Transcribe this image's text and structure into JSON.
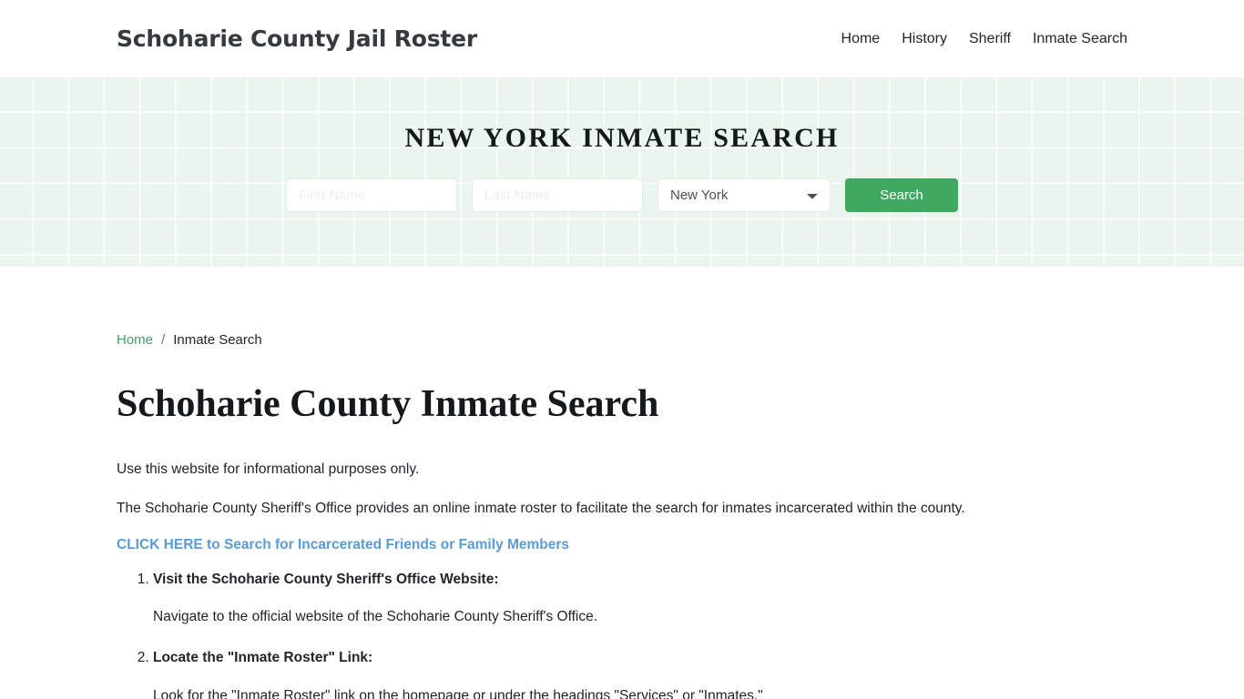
{
  "header": {
    "brand": "Schoharie County Jail Roster",
    "nav": [
      {
        "label": "Home"
      },
      {
        "label": "History"
      },
      {
        "label": "Sheriff"
      },
      {
        "label": "Inmate Search"
      }
    ]
  },
  "hero": {
    "title": "NEW YORK INMATE SEARCH",
    "background_color": "#eaf5ee",
    "form": {
      "first_name_placeholder": "First Name",
      "first_name_value": "",
      "last_name_placeholder": "Last Name",
      "last_name_value": "",
      "state_selected": "New York",
      "state_options": [
        "New York"
      ],
      "search_label": "Search",
      "search_button_color": "#3fa861"
    }
  },
  "breadcrumb": {
    "home_label": "Home",
    "separator": "/",
    "current_label": "Inmate Search",
    "link_color": "#4a9a68"
  },
  "main": {
    "page_title": "Schoharie County Inmate Search",
    "paragraph_1": "Use this website for informational purposes only.",
    "paragraph_2": "The Schoharie County Sheriff's Office provides an online inmate roster to facilitate the search for inmates incarcerated within the county.",
    "cta_link": "CLICK HERE to Search for Incarcerated Friends or Family Members",
    "cta_link_color": "#5b9bd5",
    "steps": [
      {
        "heading": "Visit the Schoharie County Sheriff's Office Website:",
        "body": "Navigate to the official website of the Schoharie County Sheriff's Office."
      },
      {
        "heading": "Locate the \"Inmate Roster\" Link:",
        "body": "Look for the \"Inmate Roster\" link on the homepage or under the headings \"Services\" or \"Inmates.\""
      }
    ]
  }
}
